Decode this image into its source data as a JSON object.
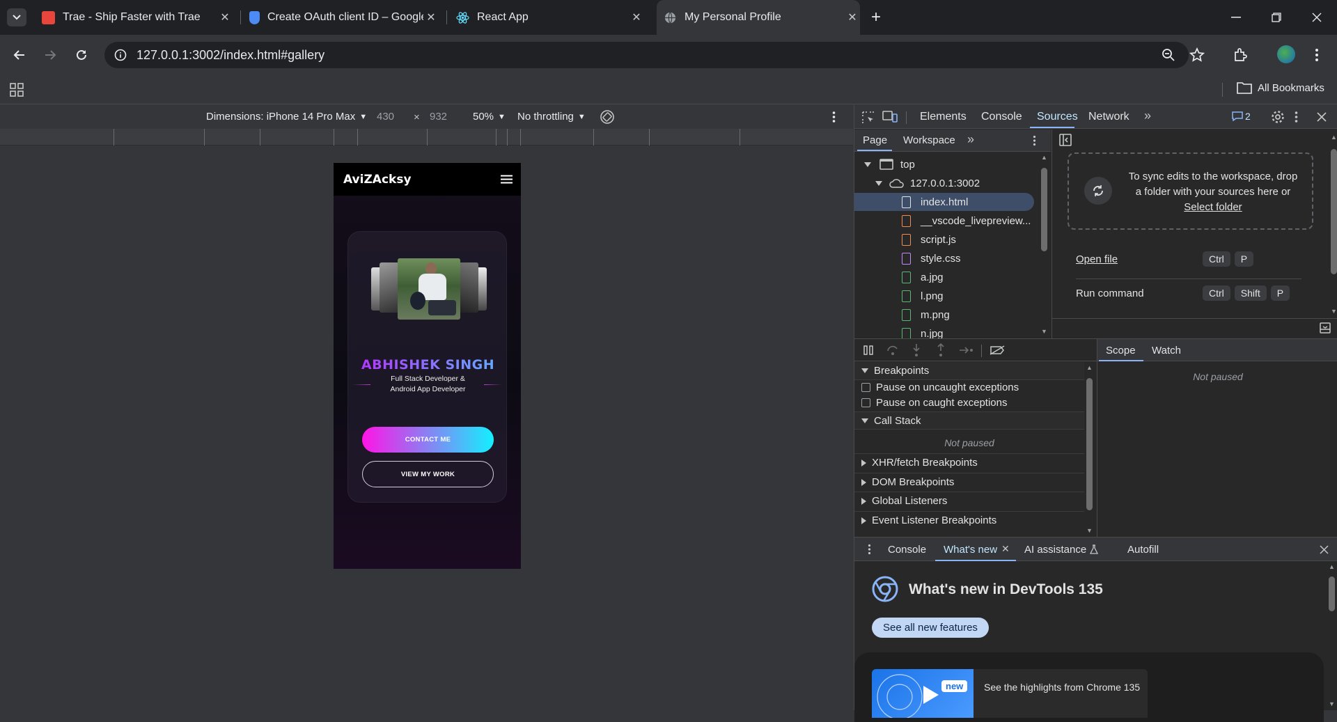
{
  "browser": {
    "tabs": [
      {
        "title": "Trae - Ship Faster with Trae",
        "favicon": "trae-icon",
        "color": "#e8453c"
      },
      {
        "title": "Create OAuth client ID – Google",
        "favicon": "shield-icon",
        "color": "#4c8bf5"
      },
      {
        "title": "React App",
        "favicon": "react-icon",
        "color": "#61dafb"
      },
      {
        "title": "My Personal Profile",
        "favicon": "globe-icon",
        "color": "#9aa0a6"
      }
    ],
    "url": "127.0.0.1:3002/index.html#gallery",
    "bookmarks_label": "All Bookmarks"
  },
  "device_toolbar": {
    "device": "Dimensions: iPhone 14 Pro Max",
    "width": "430",
    "times": "×",
    "height": "932",
    "zoom": "50%",
    "throttle": "No throttling"
  },
  "profile_site": {
    "brand": "AviZAcksy",
    "name": "ABHISHEK SINGH",
    "role_line1": "Full Stack Developer &",
    "role_line2": "Android App Developer",
    "contact_btn": "CONTACT ME",
    "work_btn": "VIEW MY WORK"
  },
  "devtools": {
    "main_tabs": [
      "Elements",
      "Console",
      "Sources",
      "Network"
    ],
    "active_tab": "Sources",
    "issues_count": "2",
    "sub_tabs": [
      "Page",
      "Workspace"
    ],
    "tree": {
      "top": "top",
      "origin": "127.0.0.1:3002",
      "files": [
        {
          "name": "index.html",
          "color": "#c4c7c5"
        },
        {
          "name": "__vscode_livepreview...",
          "color": "#f28b54"
        },
        {
          "name": "script.js",
          "color": "#f28b54"
        },
        {
          "name": "style.css",
          "color": "#c58af9"
        },
        {
          "name": "a.jpg",
          "color": "#5bb974"
        },
        {
          "name": "l.png",
          "color": "#5bb974"
        },
        {
          "name": "m.png",
          "color": "#5bb974"
        },
        {
          "name": "n.jpg",
          "color": "#5bb974"
        }
      ]
    },
    "workspace_hint": {
      "line1": "To sync edits to the workspace, drop",
      "line2": "a folder with your sources here or",
      "link": "Select folder"
    },
    "shortcuts": [
      {
        "label": "Open file",
        "keys": [
          "Ctrl",
          "P"
        ]
      },
      {
        "label": "Run command",
        "keys": [
          "Ctrl",
          "Shift",
          "P"
        ]
      }
    ],
    "debugger": {
      "breakpoints": "Breakpoints",
      "pause_uncaught": "Pause on uncaught exceptions",
      "pause_caught": "Pause on caught exceptions",
      "call_stack": "Call Stack",
      "not_paused": "Not paused",
      "xhr": "XHR/fetch Breakpoints",
      "dom": "DOM Breakpoints",
      "global": "Global Listeners",
      "event": "Event Listener Breakpoints",
      "scope_tabs": [
        "Scope",
        "Watch"
      ],
      "scope_status": "Not paused"
    },
    "drawer": {
      "tabs": [
        "Console",
        "What's new",
        "AI assistance",
        "Autofill"
      ],
      "title": "What's new in DevTools 135",
      "see_all": "See all new features",
      "badge": "new",
      "highlight": "See the highlights from Chrome 135"
    }
  }
}
